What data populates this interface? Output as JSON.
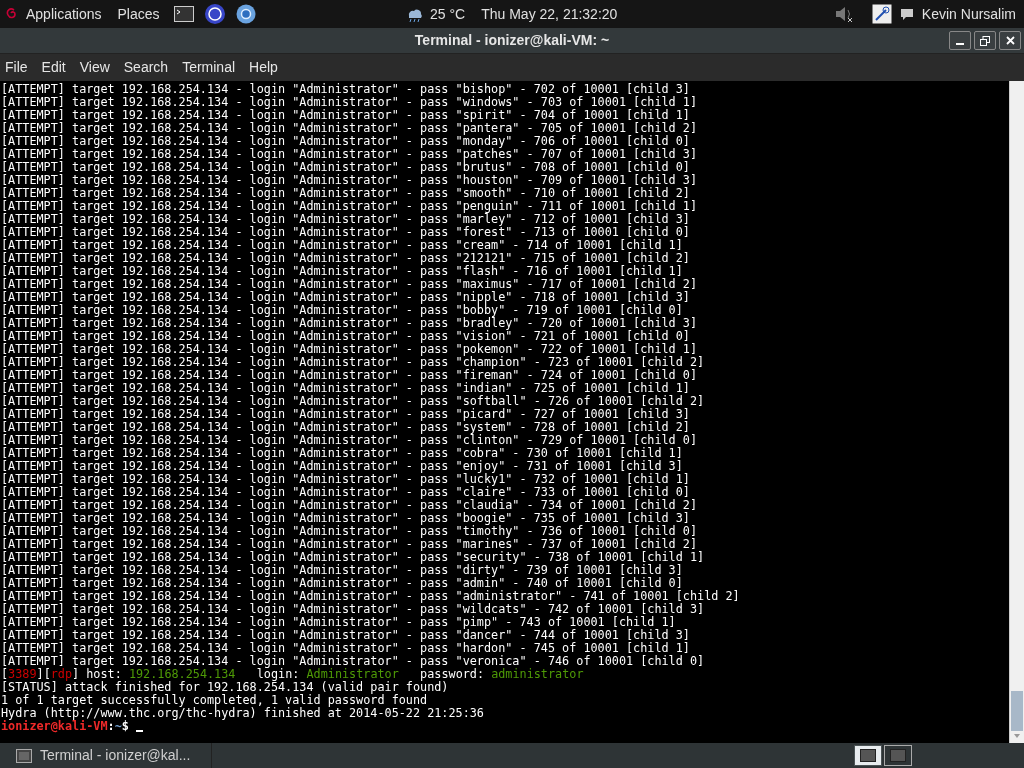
{
  "top_panel": {
    "menus": [
      "Applications",
      "Places"
    ],
    "weather": "25 °C",
    "clock": "Thu May 22, 21:32:20",
    "user": "Kevin Nursalim"
  },
  "window": {
    "title": "Terminal - ionizer@kali-VM: ~"
  },
  "menu_bar": [
    "File",
    "Edit",
    "View",
    "Search",
    "Terminal",
    "Help"
  ],
  "terminal": {
    "lines": [
      {
        "segments": [
          {
            "text": "[ATTEMPT] target 192.168.254.134 - login \"Administrator\" - pass \"bishop\" - 702 of 10001 [child 3]",
            "color": "#ffffff"
          }
        ]
      },
      {
        "segments": [
          {
            "text": "[ATTEMPT] target 192.168.254.134 - login \"Administrator\" - pass \"windows\" - 703 of 10001 [child 1]",
            "color": "#ffffff"
          }
        ]
      },
      {
        "segments": [
          {
            "text": "[ATTEMPT] target 192.168.254.134 - login \"Administrator\" - pass \"spirit\" - 704 of 10001 [child 1]",
            "color": "#ffffff"
          }
        ]
      },
      {
        "segments": [
          {
            "text": "[ATTEMPT] target 192.168.254.134 - login \"Administrator\" - pass \"pantera\" - 705 of 10001 [child 2]",
            "color": "#ffffff"
          }
        ]
      },
      {
        "segments": [
          {
            "text": "[ATTEMPT] target 192.168.254.134 - login \"Administrator\" - pass \"monday\" - 706 of 10001 [child 0]",
            "color": "#ffffff"
          }
        ]
      },
      {
        "segments": [
          {
            "text": "[ATTEMPT] target 192.168.254.134 - login \"Administrator\" - pass \"patches\" - 707 of 10001 [child 3]",
            "color": "#ffffff"
          }
        ]
      },
      {
        "segments": [
          {
            "text": "[ATTEMPT] target 192.168.254.134 - login \"Administrator\" - pass \"brutus\" - 708 of 10001 [child 0]",
            "color": "#ffffff"
          }
        ]
      },
      {
        "segments": [
          {
            "text": "[ATTEMPT] target 192.168.254.134 - login \"Administrator\" - pass \"houston\" - 709 of 10001 [child 3]",
            "color": "#ffffff"
          }
        ]
      },
      {
        "segments": [
          {
            "text": "[ATTEMPT] target 192.168.254.134 - login \"Administrator\" - pass \"smooth\" - 710 of 10001 [child 2]",
            "color": "#ffffff"
          }
        ]
      },
      {
        "segments": [
          {
            "text": "[ATTEMPT] target 192.168.254.134 - login \"Administrator\" - pass \"penguin\" - 711 of 10001 [child 1]",
            "color": "#ffffff"
          }
        ]
      },
      {
        "segments": [
          {
            "text": "[ATTEMPT] target 192.168.254.134 - login \"Administrator\" - pass \"marley\" - 712 of 10001 [child 3]",
            "color": "#ffffff"
          }
        ]
      },
      {
        "segments": [
          {
            "text": "[ATTEMPT] target 192.168.254.134 - login \"Administrator\" - pass \"forest\" - 713 of 10001 [child 0]",
            "color": "#ffffff"
          }
        ]
      },
      {
        "segments": [
          {
            "text": "[ATTEMPT] target 192.168.254.134 - login \"Administrator\" - pass \"cream\" - 714 of 10001 [child 1]",
            "color": "#ffffff"
          }
        ]
      },
      {
        "segments": [
          {
            "text": "[ATTEMPT] target 192.168.254.134 - login \"Administrator\" - pass \"212121\" - 715 of 10001 [child 2]",
            "color": "#ffffff"
          }
        ]
      },
      {
        "segments": [
          {
            "text": "[ATTEMPT] target 192.168.254.134 - login \"Administrator\" - pass \"flash\" - 716 of 10001 [child 1]",
            "color": "#ffffff"
          }
        ]
      },
      {
        "segments": [
          {
            "text": "[ATTEMPT] target 192.168.254.134 - login \"Administrator\" - pass \"maximus\" - 717 of 10001 [child 2]",
            "color": "#ffffff"
          }
        ]
      },
      {
        "segments": [
          {
            "text": "[ATTEMPT] target 192.168.254.134 - login \"Administrator\" - pass \"nipple\" - 718 of 10001 [child 3]",
            "color": "#ffffff"
          }
        ]
      },
      {
        "segments": [
          {
            "text": "[ATTEMPT] target 192.168.254.134 - login \"Administrator\" - pass \"bobby\" - 719 of 10001 [child 0]",
            "color": "#ffffff"
          }
        ]
      },
      {
        "segments": [
          {
            "text": "[ATTEMPT] target 192.168.254.134 - login \"Administrator\" - pass \"bradley\" - 720 of 10001 [child 3]",
            "color": "#ffffff"
          }
        ]
      },
      {
        "segments": [
          {
            "text": "[ATTEMPT] target 192.168.254.134 - login \"Administrator\" - pass \"vision\" - 721 of 10001 [child 0]",
            "color": "#ffffff"
          }
        ]
      },
      {
        "segments": [
          {
            "text": "[ATTEMPT] target 192.168.254.134 - login \"Administrator\" - pass \"pokemon\" - 722 of 10001 [child 1]",
            "color": "#ffffff"
          }
        ]
      },
      {
        "segments": [
          {
            "text": "[ATTEMPT] target 192.168.254.134 - login \"Administrator\" - pass \"champion\" - 723 of 10001 [child 2]",
            "color": "#ffffff"
          }
        ]
      },
      {
        "segments": [
          {
            "text": "[ATTEMPT] target 192.168.254.134 - login \"Administrator\" - pass \"fireman\" - 724 of 10001 [child 0]",
            "color": "#ffffff"
          }
        ]
      },
      {
        "segments": [
          {
            "text": "[ATTEMPT] target 192.168.254.134 - login \"Administrator\" - pass \"indian\" - 725 of 10001 [child 1]",
            "color": "#ffffff"
          }
        ]
      },
      {
        "segments": [
          {
            "text": "[ATTEMPT] target 192.168.254.134 - login \"Administrator\" - pass \"softball\" - 726 of 10001 [child 2]",
            "color": "#ffffff"
          }
        ]
      },
      {
        "segments": [
          {
            "text": "[ATTEMPT] target 192.168.254.134 - login \"Administrator\" - pass \"picard\" - 727 of 10001 [child 3]",
            "color": "#ffffff"
          }
        ]
      },
      {
        "segments": [
          {
            "text": "[ATTEMPT] target 192.168.254.134 - login \"Administrator\" - pass \"system\" - 728 of 10001 [child 2]",
            "color": "#ffffff"
          }
        ]
      },
      {
        "segments": [
          {
            "text": "[ATTEMPT] target 192.168.254.134 - login \"Administrator\" - pass \"clinton\" - 729 of 10001 [child 0]",
            "color": "#ffffff"
          }
        ]
      },
      {
        "segments": [
          {
            "text": "[ATTEMPT] target 192.168.254.134 - login \"Administrator\" - pass \"cobra\" - 730 of 10001 [child 1]",
            "color": "#ffffff"
          }
        ]
      },
      {
        "segments": [
          {
            "text": "[ATTEMPT] target 192.168.254.134 - login \"Administrator\" - pass \"enjoy\" - 731 of 10001 [child 3]",
            "color": "#ffffff"
          }
        ]
      },
      {
        "segments": [
          {
            "text": "[ATTEMPT] target 192.168.254.134 - login \"Administrator\" - pass \"lucky1\" - 732 of 10001 [child 1]",
            "color": "#ffffff"
          }
        ]
      },
      {
        "segments": [
          {
            "text": "[ATTEMPT] target 192.168.254.134 - login \"Administrator\" - pass \"claire\" - 733 of 10001 [child 0]",
            "color": "#ffffff"
          }
        ]
      },
      {
        "segments": [
          {
            "text": "[ATTEMPT] target 192.168.254.134 - login \"Administrator\" - pass \"claudia\" - 734 of 10001 [child 2]",
            "color": "#ffffff"
          }
        ]
      },
      {
        "segments": [
          {
            "text": "[ATTEMPT] target 192.168.254.134 - login \"Administrator\" - pass \"boogie\" - 735 of 10001 [child 3]",
            "color": "#ffffff"
          }
        ]
      },
      {
        "segments": [
          {
            "text": "[ATTEMPT] target 192.168.254.134 - login \"Administrator\" - pass \"timothy\" - 736 of 10001 [child 0]",
            "color": "#ffffff"
          }
        ]
      },
      {
        "segments": [
          {
            "text": "[ATTEMPT] target 192.168.254.134 - login \"Administrator\" - pass \"marines\" - 737 of 10001 [child 2]",
            "color": "#ffffff"
          }
        ]
      },
      {
        "segments": [
          {
            "text": "[ATTEMPT] target 192.168.254.134 - login \"Administrator\" - pass \"security\" - 738 of 10001 [child 1]",
            "color": "#ffffff"
          }
        ]
      },
      {
        "segments": [
          {
            "text": "[ATTEMPT] target 192.168.254.134 - login \"Administrator\" - pass \"dirty\" - 739 of 10001 [child 3]",
            "color": "#ffffff"
          }
        ]
      },
      {
        "segments": [
          {
            "text": "[ATTEMPT] target 192.168.254.134 - login \"Administrator\" - pass \"admin\" - 740 of 10001 [child 0]",
            "color": "#ffffff"
          }
        ]
      },
      {
        "segments": [
          {
            "text": "[ATTEMPT] target 192.168.254.134 - login \"Administrator\" - pass \"administrator\" - 741 of 10001 [child 2]",
            "color": "#ffffff"
          }
        ]
      },
      {
        "segments": [
          {
            "text": "[ATTEMPT] target 192.168.254.134 - login \"Administrator\" - pass \"wildcats\" - 742 of 10001 [child 3]",
            "color": "#ffffff"
          }
        ]
      },
      {
        "segments": [
          {
            "text": "[ATTEMPT] target 192.168.254.134 - login \"Administrator\" - pass \"pimp\" - 743 of 10001 [child 1]",
            "color": "#ffffff"
          }
        ]
      },
      {
        "segments": [
          {
            "text": "[ATTEMPT] target 192.168.254.134 - login \"Administrator\" - pass \"dancer\" - 744 of 10001 [child 3]",
            "color": "#ffffff"
          }
        ]
      },
      {
        "segments": [
          {
            "text": "[ATTEMPT] target 192.168.254.134 - login \"Administrator\" - pass \"hardon\" - 745 of 10001 [child 1]",
            "color": "#ffffff"
          }
        ]
      },
      {
        "segments": [
          {
            "text": "[ATTEMPT] target 192.168.254.134 - login \"Administrator\" - pass \"veronica\" - 746 of 10001 [child 0]",
            "color": "#ffffff"
          }
        ]
      },
      {
        "segments": [
          {
            "text": "[",
            "color": "#ffffff"
          },
          {
            "text": "3389",
            "color": "#cc0000"
          },
          {
            "text": "][",
            "color": "#ffffff"
          },
          {
            "text": "rdp",
            "color": "#cc0000"
          },
          {
            "text": "] host: ",
            "color": "#ffffff"
          },
          {
            "text": "192.168.254.134",
            "color": "#4e9a06"
          },
          {
            "text": "   login: ",
            "color": "#ffffff"
          },
          {
            "text": "Administrator",
            "color": "#4e9a06"
          },
          {
            "text": "   password: ",
            "color": "#ffffff"
          },
          {
            "text": "administrator",
            "color": "#4e9a06"
          }
        ]
      },
      {
        "segments": [
          {
            "text": "[STATUS] attack finished for 192.168.254.134 (valid pair found)",
            "color": "#ffffff"
          }
        ]
      },
      {
        "segments": [
          {
            "text": "1 of 1 target successfully completed, 1 valid password found",
            "color": "#ffffff"
          }
        ]
      },
      {
        "segments": [
          {
            "text": "Hydra (http://www.thc.org/thc-hydra) finished at 2014-05-22 21:25:36",
            "color": "#ffffff"
          }
        ]
      },
      {
        "segments": [
          {
            "text": "ionizer@kali-VM",
            "color": "#ef2929"
          },
          {
            "text": ":",
            "color": "#ffffff"
          },
          {
            "text": "~",
            "color": "#729fcf"
          },
          {
            "text": "$ ",
            "color": "#ffffff"
          }
        ],
        "cursor": true
      }
    ]
  },
  "taskbar": {
    "tasks": [
      {
        "label": "Terminal - ionizer@kal...",
        "selected": false
      }
    ],
    "workspaces": [
      {
        "selected": true
      },
      {
        "selected": false
      }
    ]
  }
}
